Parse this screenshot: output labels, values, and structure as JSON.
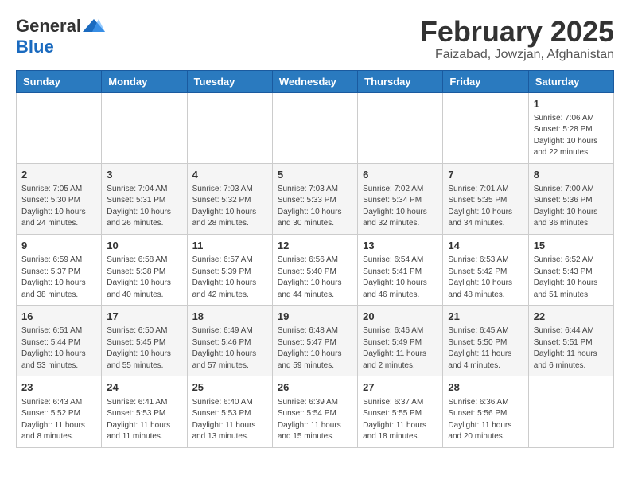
{
  "header": {
    "logo_general": "General",
    "logo_blue": "Blue",
    "month": "February 2025",
    "location": "Faizabad, Jowzjan, Afghanistan"
  },
  "days_of_week": [
    "Sunday",
    "Monday",
    "Tuesday",
    "Wednesday",
    "Thursday",
    "Friday",
    "Saturday"
  ],
  "weeks": [
    [
      {
        "day": "",
        "info": ""
      },
      {
        "day": "",
        "info": ""
      },
      {
        "day": "",
        "info": ""
      },
      {
        "day": "",
        "info": ""
      },
      {
        "day": "",
        "info": ""
      },
      {
        "day": "",
        "info": ""
      },
      {
        "day": "1",
        "info": "Sunrise: 7:06 AM\nSunset: 5:28 PM\nDaylight: 10 hours and 22 minutes."
      }
    ],
    [
      {
        "day": "2",
        "info": "Sunrise: 7:05 AM\nSunset: 5:30 PM\nDaylight: 10 hours and 24 minutes."
      },
      {
        "day": "3",
        "info": "Sunrise: 7:04 AM\nSunset: 5:31 PM\nDaylight: 10 hours and 26 minutes."
      },
      {
        "day": "4",
        "info": "Sunrise: 7:03 AM\nSunset: 5:32 PM\nDaylight: 10 hours and 28 minutes."
      },
      {
        "day": "5",
        "info": "Sunrise: 7:03 AM\nSunset: 5:33 PM\nDaylight: 10 hours and 30 minutes."
      },
      {
        "day": "6",
        "info": "Sunrise: 7:02 AM\nSunset: 5:34 PM\nDaylight: 10 hours and 32 minutes."
      },
      {
        "day": "7",
        "info": "Sunrise: 7:01 AM\nSunset: 5:35 PM\nDaylight: 10 hours and 34 minutes."
      },
      {
        "day": "8",
        "info": "Sunrise: 7:00 AM\nSunset: 5:36 PM\nDaylight: 10 hours and 36 minutes."
      }
    ],
    [
      {
        "day": "9",
        "info": "Sunrise: 6:59 AM\nSunset: 5:37 PM\nDaylight: 10 hours and 38 minutes."
      },
      {
        "day": "10",
        "info": "Sunrise: 6:58 AM\nSunset: 5:38 PM\nDaylight: 10 hours and 40 minutes."
      },
      {
        "day": "11",
        "info": "Sunrise: 6:57 AM\nSunset: 5:39 PM\nDaylight: 10 hours and 42 minutes."
      },
      {
        "day": "12",
        "info": "Sunrise: 6:56 AM\nSunset: 5:40 PM\nDaylight: 10 hours and 44 minutes."
      },
      {
        "day": "13",
        "info": "Sunrise: 6:54 AM\nSunset: 5:41 PM\nDaylight: 10 hours and 46 minutes."
      },
      {
        "day": "14",
        "info": "Sunrise: 6:53 AM\nSunset: 5:42 PM\nDaylight: 10 hours and 48 minutes."
      },
      {
        "day": "15",
        "info": "Sunrise: 6:52 AM\nSunset: 5:43 PM\nDaylight: 10 hours and 51 minutes."
      }
    ],
    [
      {
        "day": "16",
        "info": "Sunrise: 6:51 AM\nSunset: 5:44 PM\nDaylight: 10 hours and 53 minutes."
      },
      {
        "day": "17",
        "info": "Sunrise: 6:50 AM\nSunset: 5:45 PM\nDaylight: 10 hours and 55 minutes."
      },
      {
        "day": "18",
        "info": "Sunrise: 6:49 AM\nSunset: 5:46 PM\nDaylight: 10 hours and 57 minutes."
      },
      {
        "day": "19",
        "info": "Sunrise: 6:48 AM\nSunset: 5:47 PM\nDaylight: 10 hours and 59 minutes."
      },
      {
        "day": "20",
        "info": "Sunrise: 6:46 AM\nSunset: 5:49 PM\nDaylight: 11 hours and 2 minutes."
      },
      {
        "day": "21",
        "info": "Sunrise: 6:45 AM\nSunset: 5:50 PM\nDaylight: 11 hours and 4 minutes."
      },
      {
        "day": "22",
        "info": "Sunrise: 6:44 AM\nSunset: 5:51 PM\nDaylight: 11 hours and 6 minutes."
      }
    ],
    [
      {
        "day": "23",
        "info": "Sunrise: 6:43 AM\nSunset: 5:52 PM\nDaylight: 11 hours and 8 minutes."
      },
      {
        "day": "24",
        "info": "Sunrise: 6:41 AM\nSunset: 5:53 PM\nDaylight: 11 hours and 11 minutes."
      },
      {
        "day": "25",
        "info": "Sunrise: 6:40 AM\nSunset: 5:53 PM\nDaylight: 11 hours and 13 minutes."
      },
      {
        "day": "26",
        "info": "Sunrise: 6:39 AM\nSunset: 5:54 PM\nDaylight: 11 hours and 15 minutes."
      },
      {
        "day": "27",
        "info": "Sunrise: 6:37 AM\nSunset: 5:55 PM\nDaylight: 11 hours and 18 minutes."
      },
      {
        "day": "28",
        "info": "Sunrise: 6:36 AM\nSunset: 5:56 PM\nDaylight: 11 hours and 20 minutes."
      },
      {
        "day": "",
        "info": ""
      }
    ]
  ]
}
